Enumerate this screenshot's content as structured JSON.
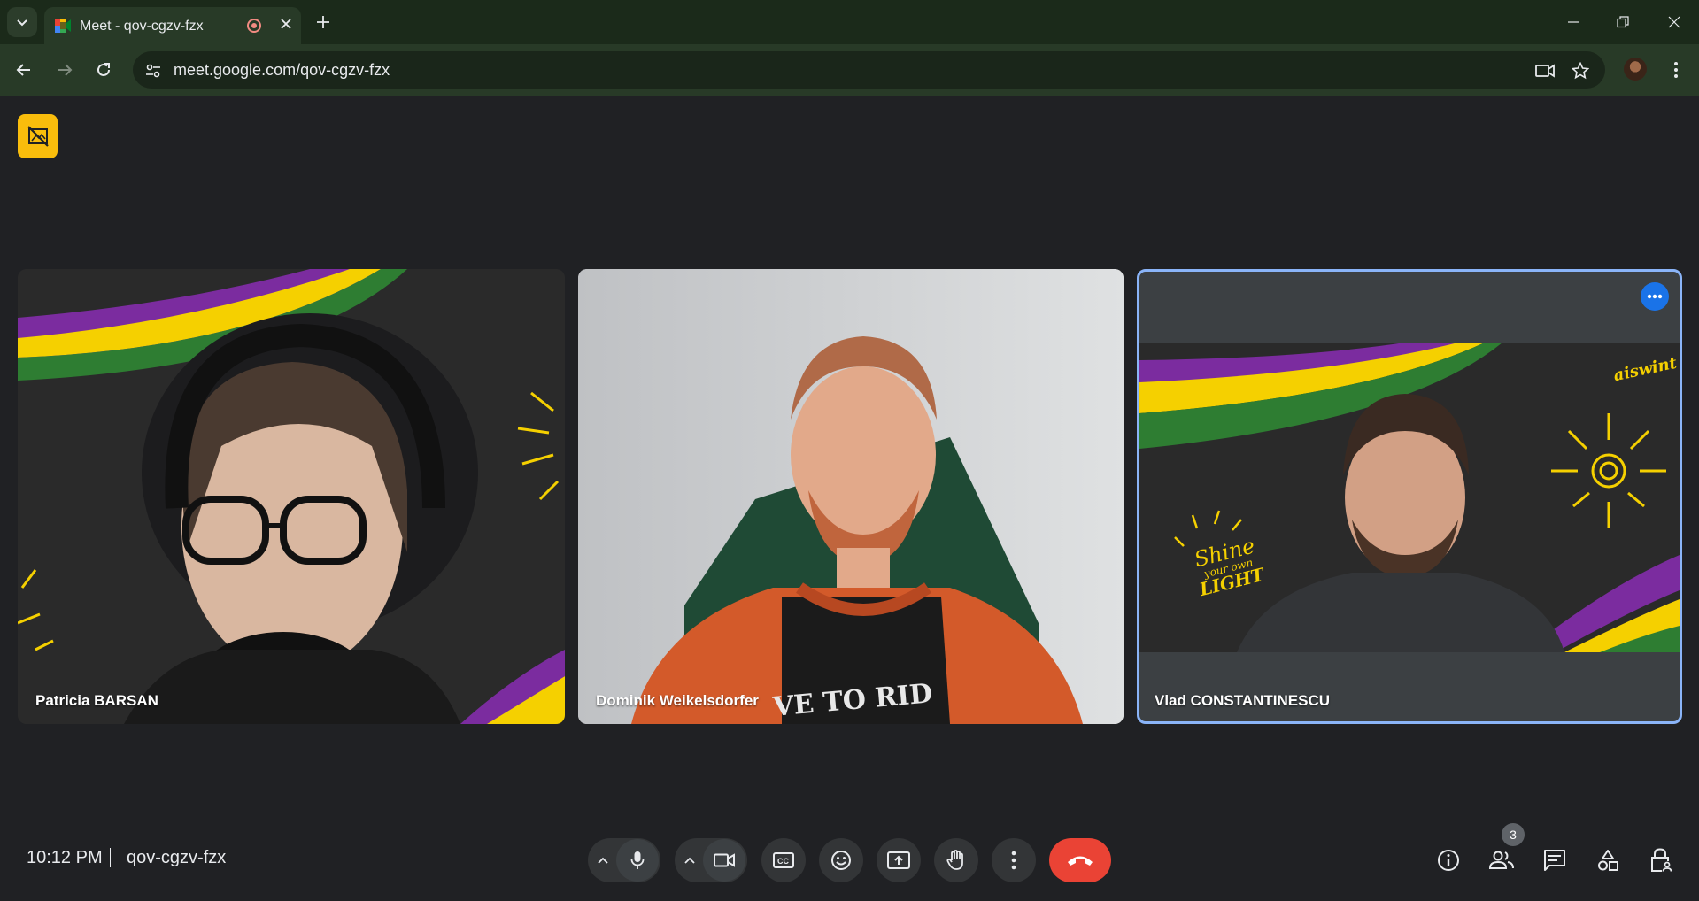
{
  "browser": {
    "tab_title": "Meet - qov-cgzv-fzx",
    "url": "meet.google.com/qov-cgzv-fzx"
  },
  "meeting": {
    "time": "10:12 PM",
    "code": "qov-cgzv-fzx",
    "participant_count": "3"
  },
  "participants": [
    {
      "name": "Patricia BARSAN"
    },
    {
      "name": "Dominik Weikelsdorfer"
    },
    {
      "name": "Vlad CONSTANTINESCU"
    }
  ],
  "background_texts": {
    "logo": "aiswint",
    "slogan_line1": "Shine",
    "slogan_line2": "your own",
    "slogan_line3": "LIGHT",
    "shirt": "VE TO RID"
  },
  "colors": {
    "accent_blue": "#1a73e8",
    "end_call_red": "#ea4335",
    "banner_yellow": "#f9bd0c",
    "stripe_purple": "#7b2c9f",
    "stripe_yellow": "#f5d000",
    "stripe_green": "#2e7d32"
  },
  "icons": {
    "tab_list": "chevron-down-icon",
    "favicon": "meet-logo-icon",
    "recording": "recording-icon",
    "mic": "mic-icon",
    "camera": "camera-icon",
    "captions": "captions-icon",
    "emoji": "emoji-icon",
    "present": "present-icon",
    "hand": "raise-hand-icon",
    "more": "more-vert-icon",
    "end": "end-call-icon",
    "info": "info-icon",
    "people": "people-icon",
    "chat": "chat-icon",
    "activities": "activities-icon",
    "host_controls": "lock-person-icon"
  }
}
